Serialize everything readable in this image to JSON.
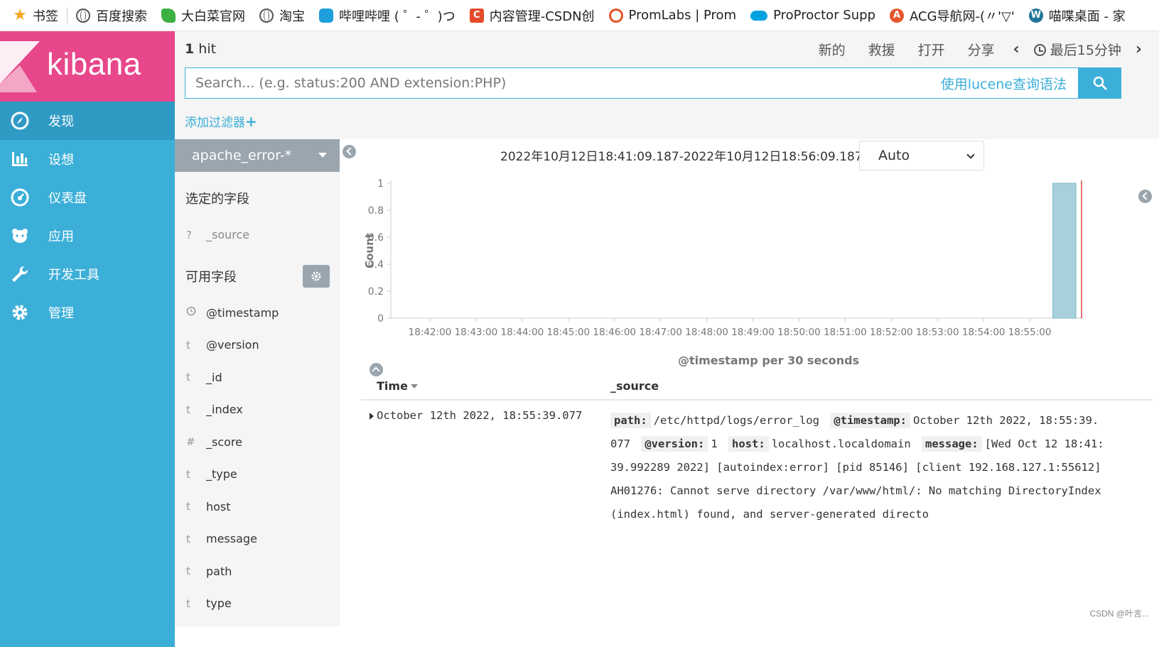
{
  "bookmarks": [
    {
      "label": "书签",
      "icon": "star-icon"
    },
    {
      "label": "百度搜索",
      "icon": "globe-icon"
    },
    {
      "label": "大白菜官网",
      "icon": "leaf-icon"
    },
    {
      "label": "淘宝",
      "icon": "globe-icon"
    },
    {
      "label": "哔哩哔哩 ( ゜- ゜)つ",
      "icon": "bilibili-icon"
    },
    {
      "label": "内容管理-CSDN创",
      "icon": "csdn-icon"
    },
    {
      "label": "PromLabs | Prom",
      "icon": "promlabs-icon"
    },
    {
      "label": "ProProctor Supp",
      "icon": "cloud-icon"
    },
    {
      "label": "ACG导航网-(〃'▽'",
      "icon": "acg-icon"
    },
    {
      "label": "喵喋桌面 - 家",
      "icon": "wordpress-icon"
    }
  ],
  "brand": {
    "name": "kibana"
  },
  "sidebar": {
    "items": [
      {
        "label": "发现",
        "icon": "compass-icon",
        "active": true
      },
      {
        "label": "设想",
        "icon": "bar-chart-icon"
      },
      {
        "label": "仪表盘",
        "icon": "dashboard-icon"
      },
      {
        "label": "应用",
        "icon": "bear-icon"
      },
      {
        "label": "开发工具",
        "icon": "wrench-icon"
      },
      {
        "label": "管理",
        "icon": "gear-icon"
      }
    ]
  },
  "topbar": {
    "hit_count": "1",
    "hit_label": " hit",
    "actions": {
      "new": "新的",
      "save": "救援",
      "open": "打开",
      "share": "分享"
    },
    "time_label": "最后15分钟"
  },
  "search": {
    "placeholder": "Search... (e.g. status:200 AND extension:PHP)",
    "value": "",
    "lucene_link": "使用lucene查询语法"
  },
  "filter": {
    "add_label": "添加过滤器",
    "plus": "+"
  },
  "fields": {
    "index_pattern": "apache_error-*",
    "selected_title": "选定的字段",
    "selected": [
      {
        "type": "?",
        "name": "_source"
      }
    ],
    "available_title": "可用字段",
    "available": [
      {
        "type": "clock",
        "name": "@timestamp"
      },
      {
        "type": "t",
        "name": "@version"
      },
      {
        "type": "t",
        "name": "_id"
      },
      {
        "type": "t",
        "name": "_index"
      },
      {
        "type": "#",
        "name": "_score"
      },
      {
        "type": "t",
        "name": "_type"
      },
      {
        "type": "t",
        "name": "host"
      },
      {
        "type": "t",
        "name": "message"
      },
      {
        "type": "t",
        "name": "path"
      },
      {
        "type": "t",
        "name": "type"
      }
    ]
  },
  "histogram": {
    "time_range": "2022年10月12日18:41:09.187-2022年10月12日18:56:09.187 —",
    "interval": "Auto"
  },
  "chart_data": {
    "type": "bar",
    "title": "",
    "xlabel": "@timestamp per 30 seconds",
    "ylabel": "Count",
    "ylim": [
      0,
      1
    ],
    "y_ticks": [
      "0",
      "0.2",
      "0.4",
      "0.6",
      "0.8",
      "1"
    ],
    "x_ticks": [
      "18:42:00",
      "18:43:00",
      "18:44:00",
      "18:45:00",
      "18:46:00",
      "18:47:00",
      "18:48:00",
      "18:49:00",
      "18:50:00",
      "18:51:00",
      "18:52:00",
      "18:53:00",
      "18:54:00",
      "18:55:00"
    ],
    "bars": [
      {
        "x": "18:55:30",
        "value": 1
      }
    ],
    "bar_color": "#a8cfdc",
    "now_marker_color": "#e57373"
  },
  "documents": {
    "col_time": "Time",
    "col_source": "_source",
    "rows": [
      {
        "time": "October 12th 2022, 18:55:39.077",
        "source": [
          {
            "k": "path:",
            "v": "/etc/httpd/logs/error_log"
          },
          {
            "k": "@timestamp:",
            "v": "October 12th 2022, 18:55:39.077"
          },
          {
            "k": "@version:",
            "v": "1"
          },
          {
            "k": "host:",
            "v": "localhost.localdomain"
          },
          {
            "k": "message:",
            "v": "[Wed Oct 12 18:41:39.992289 2022] [autoindex:error] [pid 85146] [client 192.168.127.1:55612] AH01276: Cannot serve directory /var/www/html/: No matching DirectoryIndex (index.html) found, and server-generated directo"
          }
        ]
      }
    ]
  },
  "watermark": "CSDN @叶言..."
}
